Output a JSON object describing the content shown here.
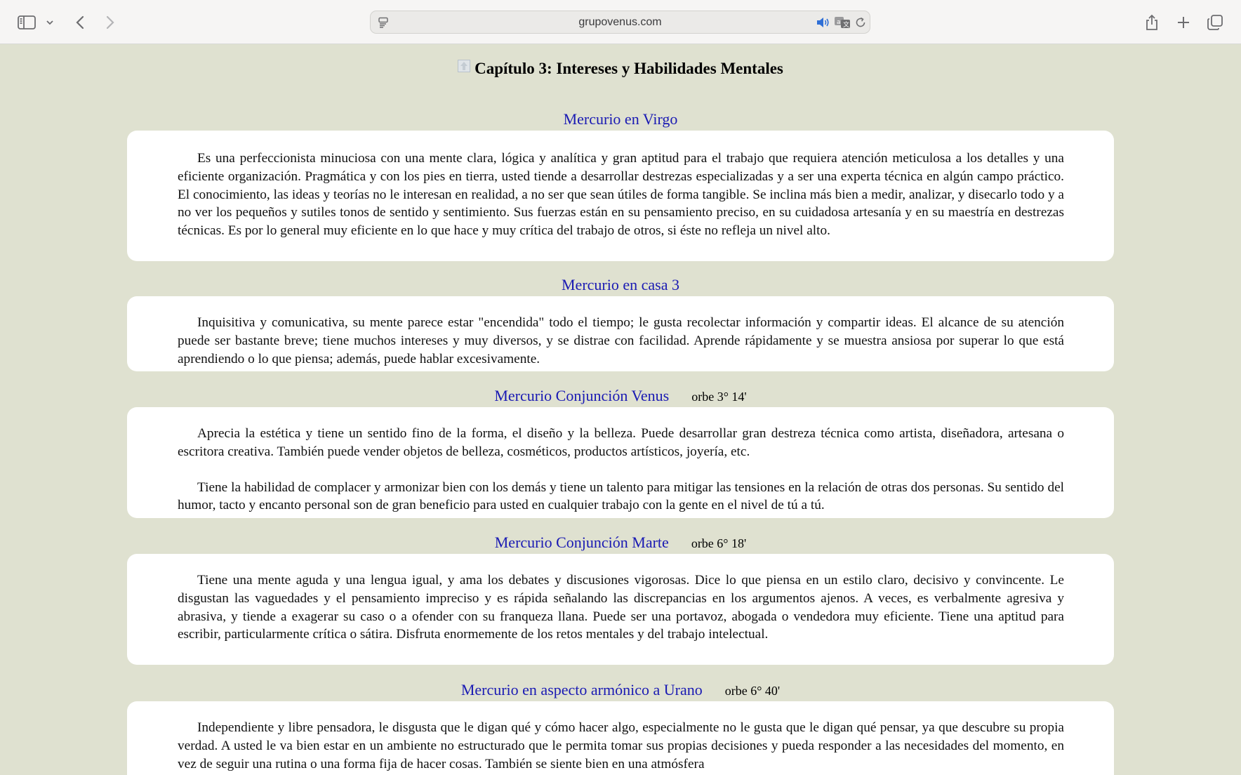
{
  "browser": {
    "url": "grupovenus.com",
    "icons": {
      "sidebar": "sidebar-icon",
      "sidebar_menu": "chevron-down-icon",
      "back": "chevron-left-icon",
      "forward": "chevron-right-icon",
      "page_menu": "page-menu-icon",
      "audio": "speaker-icon",
      "translate": "translate-icon",
      "reload": "reload-icon",
      "share": "share-icon",
      "new_tab": "plus-icon",
      "tabs": "tabs-overview-icon"
    }
  },
  "page": {
    "chapter_title": "Capítulo 3: Intereses y Habilidades Mentales",
    "sections": [
      {
        "heading": "Mercurio en Virgo",
        "orb": "",
        "paragraphs": [
          "Es una perfeccionista minuciosa con una mente clara, lógica y analítica y gran aptitud para el trabajo que requiera atención meticulosa a los detalles y una eficiente organización. Pragmática y con los pies en tierra, usted tiende a desarrollar destrezas especializadas y a ser una experta técnica en algún campo práctico. El conocimiento, las ideas y teorías no le interesan en realidad, a no ser que sean útiles de forma tangible. Se inclina más bien a medir, analizar, y disecarlo todo y a no ver los pequeños y sutiles tonos de sentido y sentimiento. Sus fuerzas están en su pensamiento preciso, en su cuidadosa artesanía y en su maestría en destrezas técnicas. Es por lo general muy eficiente en lo que hace y muy crítica del trabajo de otros, si éste no refleja un nivel alto."
        ]
      },
      {
        "heading": "Mercurio en casa 3",
        "orb": "",
        "paragraphs": [
          "Inquisitiva y comunicativa, su mente parece estar \"encendida\" todo el tiempo; le gusta recolectar información y compartir ideas. El alcance de su atención puede ser bastante breve; tiene muchos intereses y muy diversos, y se distrae con facilidad. Aprende rápidamente y se muestra ansiosa por superar lo que está aprendiendo o lo que piensa; además, puede hablar excesivamente."
        ]
      },
      {
        "heading": "Mercurio Conjunción Venus",
        "orb": "orbe 3° 14'",
        "paragraphs": [
          "Aprecia la estética y tiene un sentido fino de la forma, el diseño y la belleza. Puede desarrollar gran destreza técnica como artista, diseñadora, artesana o escritora creativa. También puede vender objetos de belleza, cosméticos, productos artísticos, joyería, etc.",
          "Tiene la habilidad de complacer y armonizar bien con los demás y tiene un talento para mitigar las tensiones en la relación de otras dos personas. Su sentido del humor, tacto y encanto personal son de gran beneficio para usted en cualquier trabajo con la gente en el nivel de tú a tú."
        ]
      },
      {
        "heading": "Mercurio Conjunción Marte",
        "orb": "orbe 6° 18'",
        "paragraphs": [
          "Tiene una mente aguda y una lengua igual, y ama los debates y discusiones vigorosas. Dice lo que piensa en un estilo claro, decisivo y convincente. Le disgustan las vaguedades y el pensamiento impreciso y es rápida señalando las discrepancias en los argumentos ajenos. A veces, es verbalmente agresiva y abrasiva, y tiende a exagerar su caso o a ofender con su franqueza llana. Puede ser una portavoz, abogada o vendedora muy eficiente. Tiene una aptitud para escribir, particularmente crítica o sátira. Disfruta enormemente de los retos mentales y del trabajo intelectual."
        ]
      },
      {
        "heading": "Mercurio en aspecto armónico a Urano",
        "orb": "orbe 6° 40'",
        "paragraphs": [
          "Independiente y libre pensadora, le disgusta que le digan qué y cómo hacer algo, especialmente no le gusta que le digan qué pensar, ya que descubre su propia verdad. A usted le va bien estar en un ambiente no estructurado que le permita tomar sus propias decisiones y pueda responder a las necesidades del momento, en vez de seguir una rutina o una forma fija de hacer cosas. También se siente bien en una atmósfera"
        ]
      }
    ]
  }
}
